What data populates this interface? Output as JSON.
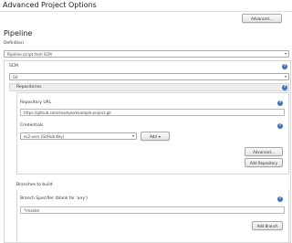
{
  "section_title": "Advanced Project Options",
  "advanced_button": "Advanced...",
  "pipeline": {
    "heading": "Pipeline",
    "definition_label": "Definition",
    "definition_value": "Pipeline script from SCM",
    "scm_label": "SCM",
    "scm_value": "Git",
    "repositories_label": "Repositories",
    "repo_url_label": "Repository URL",
    "repo_url_value": "https://github.com/example/example-project.git",
    "credentials_label": "Credentials",
    "credentials_value": "ec2-user (GitHub Key)",
    "add_button": "Add",
    "advanced_button": "Advanced...",
    "add_repository_button": "Add Repository",
    "branches_label": "Branches to build",
    "branch_specifier_label": "Branch Specifier (blank for 'any')",
    "branch_specifier_value": "*/master",
    "add_branch_button": "Add Branch",
    "help_glyph": "?",
    "delete_glyph": "X"
  },
  "colors": {
    "help_icon": "#3b74b5",
    "delete_button": "#d9252a",
    "panel_bar": "#eeeeee"
  }
}
